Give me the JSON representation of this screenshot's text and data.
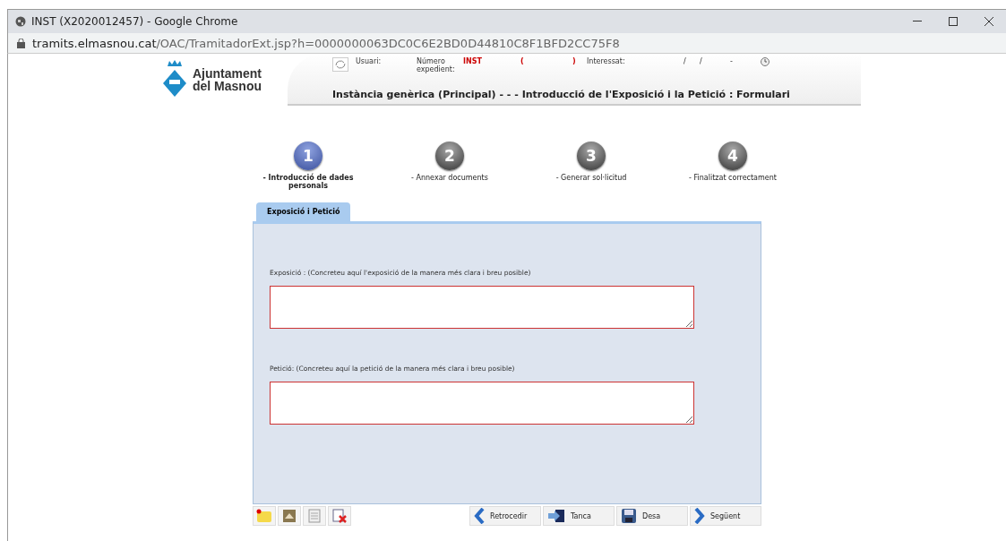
{
  "window": {
    "title": "INST (X2020012457) - Google Chrome",
    "url_host": "tramits.elmasnou.cat",
    "url_path": "/OAC/TramitadorExt.jsp?h=0000000063DC0C6E2BD0D44810C8F1BFD2CC75F8"
  },
  "logo": {
    "line_1": "Ajuntament",
    "line_2": "del Masnou"
  },
  "header": {
    "user_label": "Usuari:",
    "number_label": "Número expedient:",
    "number_prefix": "INST",
    "paren_open": "(",
    "paren_close": ")",
    "interested_label": "Interessat:",
    "slash_1": "/",
    "slash_2": "/",
    "dash": "-",
    "title": "Instància genèrica (Principal) - - - Introducció de l'Exposició i la Petició : Formulari"
  },
  "steps": [
    {
      "number": "1",
      "label": "- Introducció de dades personals",
      "selected": true
    },
    {
      "number": "2",
      "label": "- Annexar documents",
      "selected": false
    },
    {
      "number": "3",
      "label": "- Generar sol·licitud",
      "selected": false
    },
    {
      "number": "4",
      "label": "- Finalitzat correctament",
      "selected": false
    }
  ],
  "tabs": [
    {
      "label": "Exposició i Petició",
      "selected": true
    }
  ],
  "fields": [
    {
      "label": "Exposició : (Concreteu aquí l'exposició de la manera més clara i breu posible)"
    },
    {
      "label": "Petició: (Concreteu aquí la petició de la manera més clara i breu posible)"
    }
  ],
  "tools": [
    {
      "kind": "note"
    },
    {
      "kind": "image"
    },
    {
      "kind": "document"
    },
    {
      "kind": "delete"
    }
  ],
  "buttons": [
    {
      "kind": "back",
      "label": "Retrocedir"
    },
    {
      "kind": "close",
      "label": "Tanca"
    },
    {
      "kind": "save",
      "label": "Desa"
    },
    {
      "kind": "next",
      "label": "Següent"
    }
  ]
}
